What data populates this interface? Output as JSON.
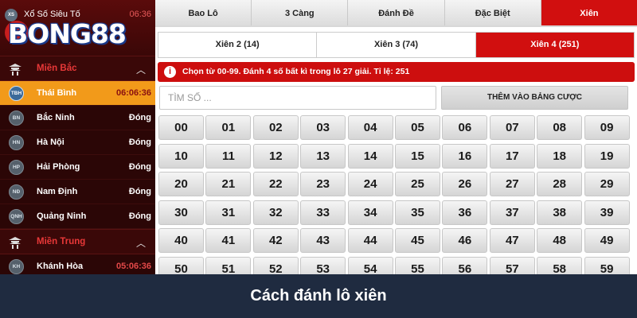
{
  "sidebar": {
    "top_item": {
      "badge": "XS",
      "title": "Xổ Số Siêu Tố",
      "time": "06:36"
    },
    "logo": "BONG88",
    "regions": [
      {
        "label": "Miền Bắc",
        "icon": "pagoda-icon",
        "provinces": [
          {
            "badge": "TBH",
            "name": "Thái Bình",
            "status": "06:06:36",
            "active": true
          },
          {
            "badge": "BN",
            "name": "Bắc Ninh",
            "status": "Đóng"
          },
          {
            "badge": "HN",
            "name": "Hà Nội",
            "status": "Đóng"
          },
          {
            "badge": "HP",
            "name": "Hải Phòng",
            "status": "Đóng"
          },
          {
            "badge": "NĐ",
            "name": "Nam Định",
            "status": "Đóng"
          },
          {
            "badge": "QNH",
            "name": "Quảng Ninh",
            "status": "Đóng"
          }
        ]
      },
      {
        "label": "Miền Trung",
        "icon": "temple-icon",
        "provinces": [
          {
            "badge": "KH",
            "name": "Khánh Hòa",
            "status": "05:06:36"
          }
        ]
      }
    ]
  },
  "bet_types": [
    "Bao Lô",
    "3 Càng",
    "Đánh Đề",
    "Đặc Biệt",
    "Xiên"
  ],
  "active_bet_type": "Xiên",
  "xien_tabs": [
    "Xiên 2 (14)",
    "Xiên 3 (74)",
    "Xiên 4 (251)"
  ],
  "active_xien_tab": "Xiên 4 (251)",
  "notice": "Chọn từ 00-99. Đánh 4 số bất kì trong lô 27 giải. Tỉ lệ: 251",
  "search": {
    "placeholder": "TÌM SỐ ...",
    "value": ""
  },
  "add_button": "THÊM VÀO BẢNG CƯỢC",
  "numbers": [
    "00",
    "01",
    "02",
    "03",
    "04",
    "05",
    "06",
    "07",
    "08",
    "09",
    "10",
    "11",
    "12",
    "13",
    "14",
    "15",
    "16",
    "17",
    "18",
    "19",
    "20",
    "21",
    "22",
    "23",
    "24",
    "25",
    "26",
    "27",
    "28",
    "29",
    "30",
    "31",
    "32",
    "33",
    "34",
    "35",
    "36",
    "37",
    "38",
    "39",
    "40",
    "41",
    "42",
    "43",
    "44",
    "45",
    "46",
    "47",
    "48",
    "49",
    "50",
    "51",
    "52",
    "53",
    "54",
    "55",
    "56",
    "57",
    "58",
    "59"
  ],
  "caption": "Cách đánh lô xiên",
  "colors": {
    "accent_red": "#d10f0f",
    "active_province": "#f29a1a",
    "sidebar_bg": "#2b0606",
    "caption_bg": "#1f2b40"
  }
}
